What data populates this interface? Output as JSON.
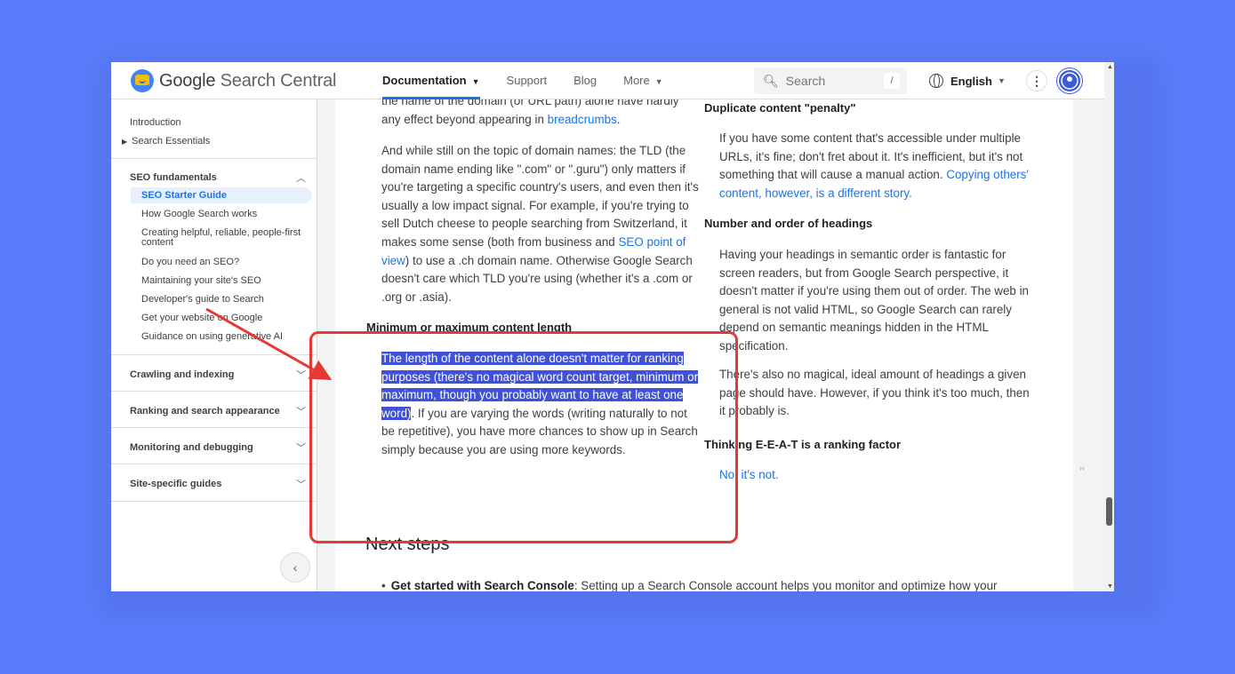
{
  "header": {
    "logo_google": "Google",
    "logo_rest": " Search Central",
    "nav": [
      {
        "label": "Documentation"
      },
      {
        "label": "Support"
      },
      {
        "label": "Blog"
      },
      {
        "label": "More"
      }
    ],
    "search_placeholder": "Search",
    "search_shortcut": "/",
    "language": "English",
    "kebab": "⋮"
  },
  "sidebar": {
    "top_links": [
      "Introduction",
      "Search Essentials"
    ],
    "seo_section": "SEO fundamentals",
    "seo_items": [
      "SEO Starter Guide",
      "How Google Search works",
      "Creating helpful, reliable, people-first content",
      "Do you need an SEO?",
      "Maintaining your site's SEO",
      "Developer's guide to Search",
      "Get your website on Google",
      "Guidance on using generative AI"
    ],
    "sections": [
      "Crawling and indexing",
      "Ranking and search appearance",
      "Monitoring and debugging",
      "Site-specific guides"
    ],
    "collapse": "‹"
  },
  "content": {
    "left": {
      "p0a": "the name of the domain (or URL path) alone have hardly",
      "p0b": "any effect beyond appearing in ",
      "p0_link": "breadcrumbs",
      "p0_end": ".",
      "p1_a": "And while still on the topic of domain names: the TLD (the domain name ending like \".com\" or \".guru\") only matters if you're targeting a specific country's users, and even then it's usually a low impact signal. For example, if you're trying to sell Dutch cheese to people searching from Switzerland, it makes some sense (both from business and ",
      "p1_link": "SEO point of view",
      "p1_b": ") to use a .ch domain name. Otherwise Google Search doesn't care which TLD you're using (whether it's a .com or .org or .asia).",
      "h_min": "Minimum or maximum content length",
      "p2_selected": "The length of the content alone doesn't matter for ranking purposes (there's no magical word count target, minimum or maximum, though you probably want to have at least one word)",
      "p2_rest": ". If you are varying the words (writing naturally to not be repetitive), you have more chances to show up in Search simply because you are using more keywords."
    },
    "right": {
      "h_dup": "Duplicate content \"penalty\"",
      "p_dup": "If you have some content that's accessible under multiple URLs, it's fine; don't fret about it. It's inefficient, but it's not something that will cause a manual action. ",
      "p_dup_link": "Copying others' content, however, is a different story.",
      "h_head": "Number and order of headings",
      "p_head": "Having your headings in semantic order is fantastic for screen readers, but from Google Search perspective, it doesn't matter if you're using them out of order. The web in general is not valid HTML, so Google Search can rarely depend on semantic meanings hidden in the HTML specification.",
      "p_head2": "There's also no magical, ideal amount of headings a given page should have. However, if you think it's too much, then it probably is.",
      "h_eeat": "Thinking E-E-A-T is a ranking factor",
      "p_eeat": "No, it's not."
    },
    "next_steps": "Next steps",
    "bullet_bold": "Get started with Search Console",
    "bullet_rest": ": Setting up a Search Console account helps you monitor and optimize how your"
  },
  "colors": {
    "background": "#5b7cfa",
    "link": "#1a73e8",
    "selection": "#3f51d6",
    "annotation": "#e53935"
  }
}
